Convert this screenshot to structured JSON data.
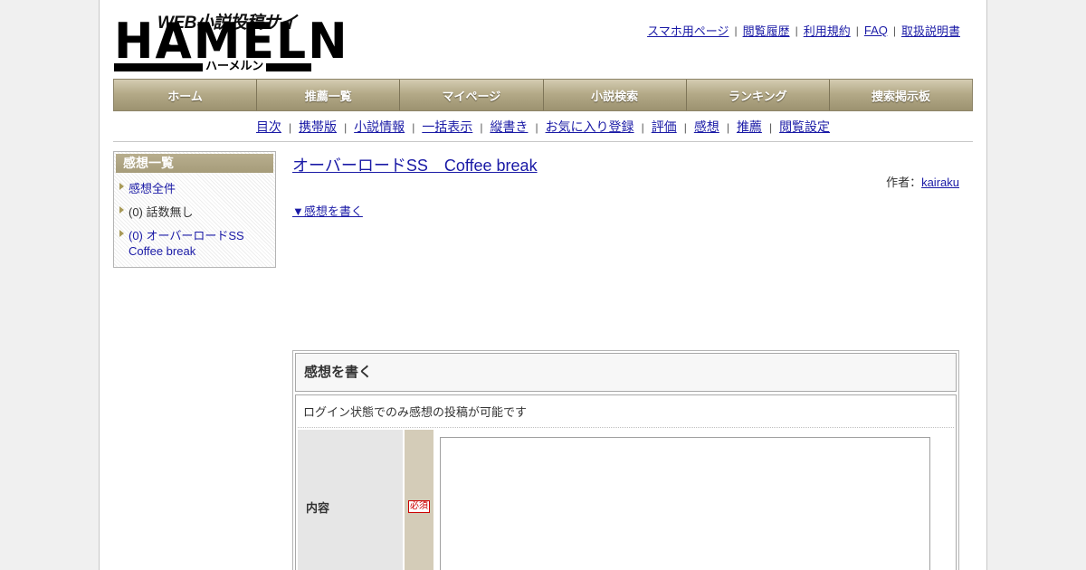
{
  "logo": {
    "tagline": "WEB小説投稿サイト",
    "word": "HAMELN",
    "kana": "ハーメルン"
  },
  "toplinks": [
    "スマホ用ページ",
    "閲覧履歴",
    "利用規約",
    "FAQ",
    "取扱説明書"
  ],
  "mainnav": [
    "ホーム",
    "推薦一覧",
    "マイページ",
    "小説検索",
    "ランキング",
    "捜索掲示板"
  ],
  "subnav": [
    "目次",
    "携帯版",
    "小説情報",
    "一括表示",
    "縦書き",
    "お気に入り登録",
    "評価",
    "感想",
    "推薦",
    "閲覧設定"
  ],
  "sidebar": {
    "heading": "感想一覧",
    "items": [
      {
        "label": "感想全件"
      },
      {
        "label": "(0) 話数無し"
      },
      {
        "label": "(0) オーバーロードSS Coffee break"
      }
    ]
  },
  "content": {
    "title": "オーバーロードSS　Coffee break",
    "author_prefix": "作者：",
    "author_name": "kairaku",
    "write_link": "▼感想を書く"
  },
  "form": {
    "heading": "感想を書く",
    "login_note": "ログイン状態でのみ感想の投稿が可能です",
    "content_label": "内容",
    "required_badge": "必須",
    "textarea_value": ""
  },
  "colors": {
    "link": "#1a1aa6",
    "nav_gradient_top": "#d4ccb2",
    "nav_gradient_bottom": "#9c9270",
    "required": "#cc0000"
  }
}
